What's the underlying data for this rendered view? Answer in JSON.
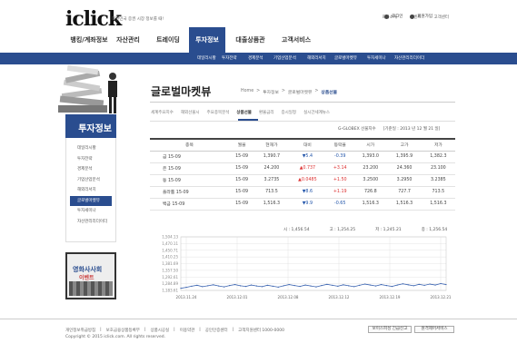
{
  "header": {
    "logo": "iclick",
    "slogan": "대한민국 증권 시장 정보를 때!",
    "top_links": [
      "회사소개",
      "이벤트",
      "고객센터"
    ],
    "user_links": [
      "로그인",
      "회원가입"
    ]
  },
  "nav": {
    "items": [
      "뱅킹/계좌정보",
      "자산관리",
      "트레이딩",
      "투자정보",
      "대출상품관",
      "고객서비스"
    ],
    "active_index": 3,
    "sub_items": [
      "데일리시황",
      "투자전략",
      "경제분석",
      "기업산업분석",
      "해외리서치",
      "글로벌마켓뷰",
      "투자세미나",
      "자산관리리더이더"
    ]
  },
  "side": {
    "title": "투자정보",
    "menu": [
      "데일리시황",
      "투자전략",
      "경제분석",
      "기업산업분석",
      "해외리서치",
      "글로벌마켓뷰",
      "투자세미나",
      "자산관리리더이더"
    ],
    "active_index": 5,
    "banner_line1": "영화사사회",
    "banner_line2": "이벤트"
  },
  "content": {
    "title": "글로벌마켓뷰",
    "breadcrumb": [
      "Home",
      "투자정보",
      "글로벌마켓뷰",
      "상품선물"
    ],
    "tabs": [
      "세계주요지수",
      "해외선물시",
      "주요종목분석",
      "상품선물",
      "환율금리",
      "증시일정",
      "실시간세계뉴스"
    ],
    "active_tab": 3,
    "table_source": "G-GLOBEX 선물지수",
    "table_date": "[기준일 : 2013 년 12 월 21 일]"
  },
  "table": {
    "headers": [
      "종목",
      "월물",
      "현재가",
      "대비",
      "등락율",
      "시가",
      "고가",
      "저가"
    ],
    "rows": [
      {
        "name": "금 15-09",
        "month": "15-09",
        "price": "1,390.7",
        "change": "▼5.4",
        "rate": "-0.39",
        "open": "1,393.0",
        "high": "1,395.9",
        "low": "1,382.3",
        "dir": "dn"
      },
      {
        "name": "은 15-09",
        "month": "15-09",
        "price": "24.200",
        "change": "▲0.737",
        "rate": "+3.14",
        "open": "23.200",
        "high": "24.360",
        "low": "23.100",
        "dir": "up"
      },
      {
        "name": "동 15-09",
        "month": "15-09",
        "price": "3.2735",
        "change": "▲0.0485",
        "rate": "+1.50",
        "open": "3.2500",
        "high": "3.2950",
        "low": "3.2385",
        "dir": "up"
      },
      {
        "name": "플라튬 15-09",
        "month": "15-09",
        "price": "713.5",
        "change": "▼8.6",
        "rate": "+1.19",
        "open": "726.8",
        "high": "727.7",
        "low": "713.5",
        "dir": "dn"
      },
      {
        "name": "백금 15-09",
        "month": "15-09",
        "price": "1,516.3",
        "change": "▼9.9",
        "rate": "-0.65",
        "open": "1,516.3",
        "high": "1,516.3",
        "low": "1,516.3",
        "dir": "dn"
      }
    ]
  },
  "legend": [
    "시 : 1,456.54",
    "고 : 1,254.25",
    "저 : 1,245.21",
    "종 : 1,256.54"
  ],
  "chart_data": {
    "type": "line",
    "y_ticks": [
      "1,504.13",
      "1,470.11",
      "1,450.71",
      "1,410.25",
      "1,381.69",
      "1,357.50",
      "1,292.61",
      "1,284.89",
      "1,183.61"
    ],
    "x_ticks": [
      "2013.11.24",
      "2013.12.01",
      "2013.12.08",
      "2013.12.12",
      "2013.12.19",
      "2013.12.21"
    ],
    "values": [
      1292,
      1296,
      1301,
      1305,
      1299,
      1303,
      1307,
      1302,
      1298,
      1304,
      1308,
      1303,
      1300,
      1306,
      1302,
      1299,
      1305,
      1301,
      1297,
      1303,
      1308,
      1304,
      1300,
      1306,
      1302,
      1298,
      1304,
      1309,
      1305,
      1301,
      1307,
      1303,
      1299,
      1305,
      1310,
      1306,
      1302,
      1308,
      1304,
      1300,
      1306,
      1311,
      1307,
      1303,
      1309,
      1305,
      1310,
      1306,
      1312,
      1308
    ],
    "ylim": [
      1283,
      1512
    ]
  },
  "footer": {
    "links": [
      "개인정보취급방침",
      "보호금융상품등록부",
      "상품시공실",
      "이용약관",
      "공인인증센터",
      "고객지원센터 1000-0000"
    ],
    "copyright": "Copyright © 2015 iclick.com. All rights reserved.",
    "buttons": [
      "보이스피싱 긴급신고",
      "원격제어서비스"
    ]
  },
  "colors": {
    "brand": "#2a4d8f",
    "up": "#d33",
    "down": "#25a"
  }
}
